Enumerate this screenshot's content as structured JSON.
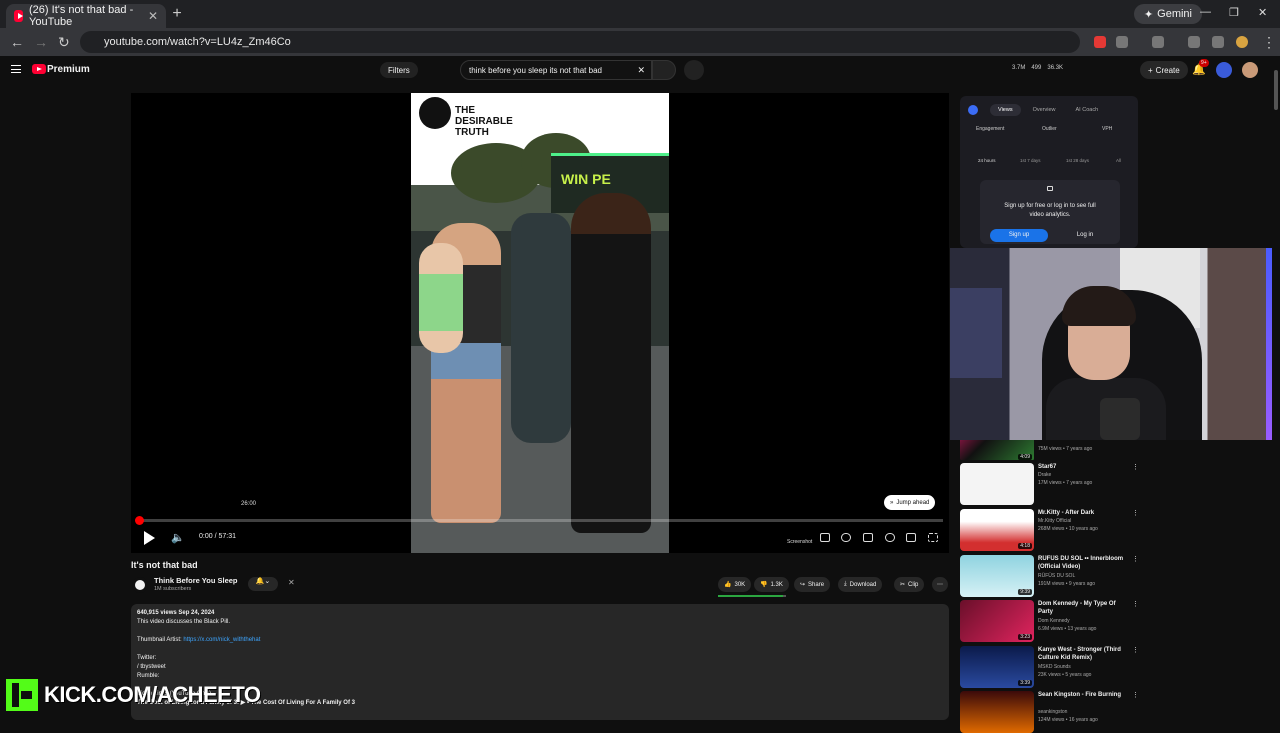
{
  "browser": {
    "tab_title": "(26) It's not that bad - YouTube",
    "tab_close": "✕",
    "new_tab": "+",
    "gemini_label": "Gemini",
    "url": "youtube.com/watch?v=LU4z_Zm46Co"
  },
  "header": {
    "premium_label": "Premium",
    "filters_label": "Filters",
    "search_value": "think before you sleep its not that bad",
    "stats": [
      "3.7M",
      "499",
      "36.3K"
    ],
    "create_label": "Create",
    "notif_count": "9+"
  },
  "player": {
    "brand_text": "THE DESIRABLE TRUTH",
    "store_sign": "WIN PE",
    "hover_time": "26:00",
    "time_display": "0:00 / 57:31",
    "progress_fraction": 0.004,
    "screenshot_label": "Screenshot",
    "jump_label": "Jump ahead"
  },
  "video": {
    "title": "It's not that bad",
    "channel_name": "Think Before You Sleep",
    "subscribers": "1M subscribers",
    "likes": "30K",
    "dislikes": "1.3K",
    "share_label": "Share",
    "download_label": "Download",
    "clip_label": "Clip",
    "like_ratio": 0.96
  },
  "description": {
    "meta": "640,915 views  Sep 24, 2024",
    "line1": "This video discusses the Black Pill.",
    "thumb_label": "Thumbnail Artist: ",
    "thumb_link": "https://x.com/nick_withthehat",
    "twitter_label": "Twitter:",
    "twitter_handle": " / tbystweet",
    "rumble_label": "Rumble:",
    "video_links": "Video Links (YouTube Only)",
    "last_line": "The Cost of Living for a Family of 3:  ▶ • The Cost Of Living For A Family Of 3"
  },
  "overlay": {
    "kick_text": "KICK.COM/ACHEETO"
  },
  "analytics": {
    "tabs": [
      "Views",
      "Overview",
      "AI Coach"
    ],
    "labels": [
      "Engagement",
      "Outlier",
      "VPH"
    ],
    "ranges": [
      "24 hours",
      "1st 7 days",
      "1st 28 days",
      "All"
    ],
    "message": "Sign up for free or log in to see full video analytics.",
    "signup_label": "Sign up",
    "login_label": "Log in"
  },
  "recommendations": [
    {
      "title": "",
      "channel": "",
      "meta": "75M views • 7 years ago",
      "duration": "4:09"
    },
    {
      "title": "Star67",
      "channel": "Drake",
      "meta": "17M views • 7 years ago",
      "duration": ""
    },
    {
      "title": "Mr.Kitty - After Dark",
      "channel": "Mr.Kitty Official",
      "meta": "268M views • 10 years ago",
      "duration": "4:18"
    },
    {
      "title": "RÜFÜS DU SOL •• Innerbloom (Official Video)",
      "channel": "RÜFÜS DU SOL",
      "meta": "191M views • 9 years ago",
      "duration": "9:39"
    },
    {
      "title": "Dom Kennedy - My Type Of Party",
      "channel": "Dom Kennedy",
      "meta": "6.9M views • 13 years ago",
      "duration": "3:23"
    },
    {
      "title": "Kanye West - Stronger (Third Culture Kid Remix)",
      "channel": "MSKD Sounds",
      "meta": "23K views • 5 years ago",
      "duration": "3:39"
    },
    {
      "title": "Sean Kingston - Fire Burning",
      "channel": "seankingston",
      "meta": "124M views • 16 years ago",
      "duration": ""
    }
  ],
  "colors": {
    "accent": "#ff0033",
    "link": "#3ea6ff",
    "kick": "#53fc18"
  }
}
